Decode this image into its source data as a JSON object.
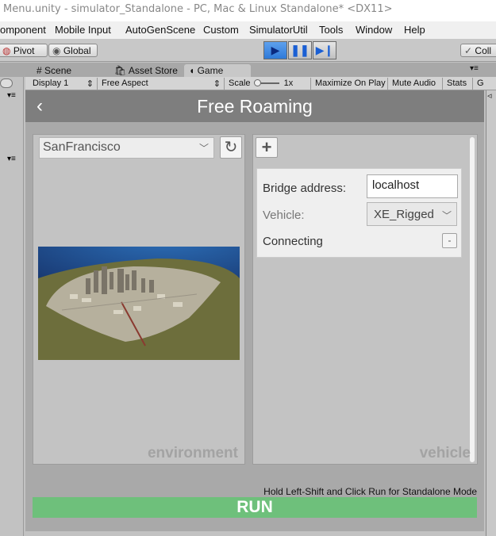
{
  "window": {
    "title": "Menu.unity - simulator_Standalone - PC, Mac & Linux Standalone* <DX11>"
  },
  "menu": [
    "omponent",
    "Mobile Input",
    "AutoGenScene",
    "Custom",
    "SimulatorUtil",
    "Tools",
    "Window",
    "Help"
  ],
  "toolbar": {
    "pivot": "Pivot",
    "global": "Global",
    "collab": "Coll"
  },
  "tabs": {
    "scene": "Scene",
    "asset_store": "Asset Store",
    "game": "Game"
  },
  "gamebar": {
    "display": "Display 1",
    "aspect": "Free Aspect",
    "scale_label": "Scale",
    "scale_value": "1x",
    "maximize": "Maximize On Play",
    "mute": "Mute Audio",
    "stats": "Stats",
    "gizmos": "G"
  },
  "app": {
    "title": "Free Roaming",
    "environment": {
      "selected": "SanFrancisco",
      "watermark": "environment"
    },
    "vehicle": {
      "watermark": "vehicle",
      "bridge_label": "Bridge address:",
      "bridge_value": "localhost",
      "vehicle_label": "Vehicle:",
      "vehicle_value": "XE_Rigged",
      "status_label": "Connecting",
      "remove_label": "-"
    },
    "hint": "Hold Left-Shift and Click Run for Standalone Mode",
    "run_label": "RUN"
  },
  "colors": {
    "run": "#6ec07b",
    "header": "#7e7e7e",
    "play_active": "#2f7ad8"
  }
}
